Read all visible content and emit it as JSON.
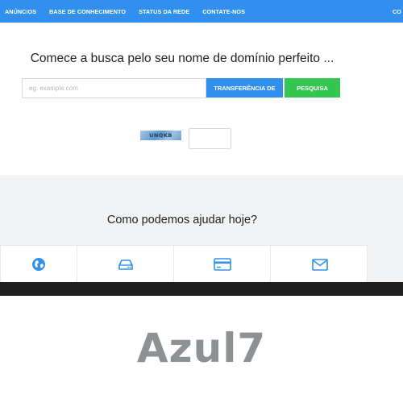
{
  "nav": {
    "items": [
      "ANÚNCIOS",
      "BASE DE CONHECIMENTO",
      "STATUS DA REDE",
      "CONTATE-NOS"
    ],
    "cut_item": "CO"
  },
  "search": {
    "headline": "Comece a busca pelo seu nome de domínio perfeito ...",
    "placeholder": "eg. example.com",
    "transfer_label": "TRANSFERÊNCIA DE",
    "search_label": "PESQUISA"
  },
  "captcha": {
    "code": "UNQKB"
  },
  "help": {
    "title": "Como podemos ajudar hoje?",
    "cards": [
      {
        "icon": "globe-icon"
      },
      {
        "icon": "server-icon"
      },
      {
        "icon": "credit-card-icon"
      },
      {
        "icon": "envelope-icon"
      }
    ]
  },
  "brand": {
    "name": "Azul7"
  },
  "colors": {
    "nav_blue": "#3190ed",
    "search_green": "#35c651",
    "help_bg": "#f1f3f5",
    "brand_gray": "#8e9194"
  }
}
